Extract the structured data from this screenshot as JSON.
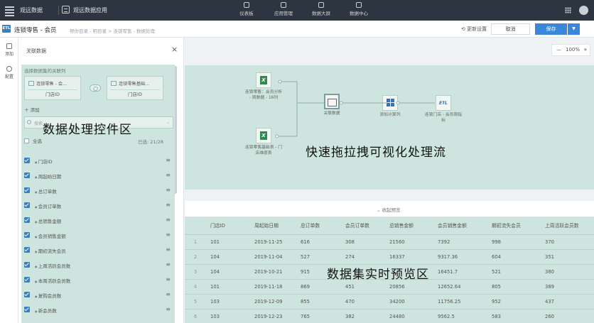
{
  "topbar": {
    "brand": "观远数据",
    "app": "观远数据应用",
    "nav": [
      "仪表板",
      "应用管理",
      "数据大屏",
      "数据中心"
    ]
  },
  "subbar": {
    "dataset_title": "连锁零售 - 会员",
    "breadcrumb": "帮你目录 - 明目录 > 连锁零售 - 数据处理",
    "reset": "更新设置",
    "cancel": "取消",
    "save": "保存"
  },
  "leftbar": {
    "add": "添加",
    "config": "配置"
  },
  "panel": {
    "title": "关联数据",
    "select_label": "选择数据集的关联列",
    "left_dataset": {
      "name": "连锁零售 - 会…",
      "field": "门店ID"
    },
    "right_dataset": {
      "name": "连锁零售基础…",
      "field": "门店ID"
    },
    "add": "添加",
    "search_placeholder": "搜索",
    "select_all": "全选",
    "selected_count": "已选: 21/28",
    "fields": [
      "门店ID",
      "周起始日期",
      "总订单数",
      "会员订单数",
      "总销售金额",
      "会员销售金额",
      "期初流失会员",
      "上周活跃会员数",
      "本周活跃会员数",
      "复购会员数",
      "新会员数"
    ]
  },
  "overlays": {
    "left": "数据处理控件区",
    "flow": "快速拖拉拽可视化处理流",
    "table": "数据集实时预览区"
  },
  "zoom": {
    "minus": "—",
    "level": "100%",
    "plus": "+"
  },
  "flow": {
    "nodes": [
      {
        "icon": "excel-icon",
        "label1": "连锁零售：会员分析",
        "label2": "- 周数据 - 16列"
      },
      {
        "icon": "excel-icon",
        "label1": "连锁零售基础表 - 门",
        "label2": "店维度表"
      },
      {
        "icon": "join-icon",
        "label1": "关联数据",
        "label2": ""
      },
      {
        "icon": "calc-icon",
        "label1": "添加计算列",
        "label2": ""
      },
      {
        "icon": "etl-icon",
        "label1": "连锁门店 - 会员周指",
        "label2": "标"
      }
    ]
  },
  "preview": {
    "collapse": "收起预览",
    "columns": [
      "门店ID",
      "周起始日期",
      "总订单数",
      "会员订单数",
      "总销售金额",
      "会员销售金额",
      "期初流失会员",
      "上周活跃会员数"
    ],
    "rows": [
      [
        "1",
        "101",
        "2019-11-25",
        "616",
        "308",
        "21560",
        "7392",
        "998",
        "370"
      ],
      [
        "2",
        "104",
        "2019-11-04",
        "527",
        "274",
        "16337",
        "9317.36",
        "604",
        "351"
      ],
      [
        "3",
        "104",
        "2019-10-21",
        "915",
        "",
        "",
        "16451.7",
        "521",
        "380"
      ],
      [
        "4",
        "101",
        "2019-11-18",
        "869",
        "451",
        "20856",
        "12652.64",
        "805",
        "389"
      ],
      [
        "5",
        "103",
        "2019-12-09",
        "855",
        "470",
        "34200",
        "11756.25",
        "952",
        "437"
      ],
      [
        "6",
        "103",
        "2019-12-23",
        "765",
        "382",
        "24480",
        "9562.5",
        "583",
        "260"
      ]
    ]
  }
}
